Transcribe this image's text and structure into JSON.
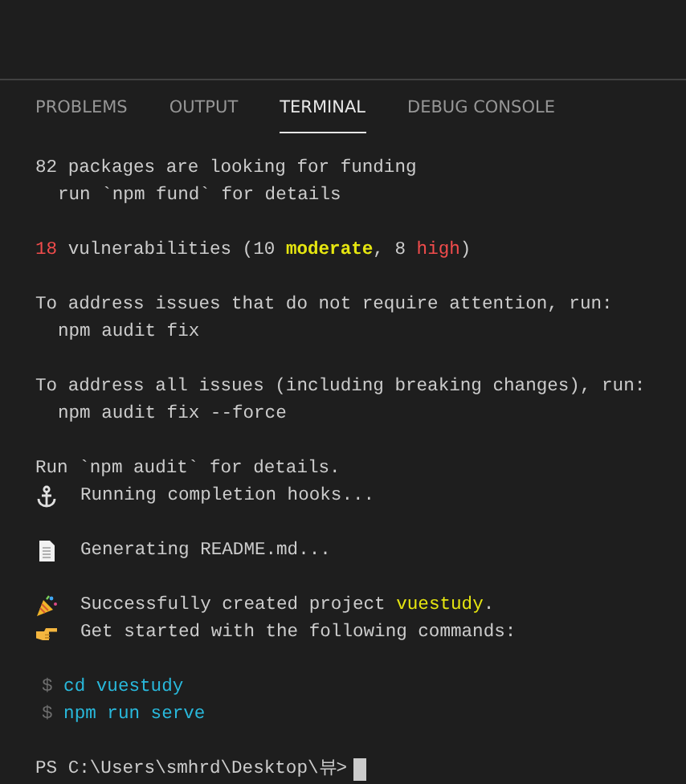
{
  "tabs": [
    {
      "label": "PROBLEMS",
      "selected": false
    },
    {
      "label": "OUTPUT",
      "selected": false
    },
    {
      "label": "TERMINAL",
      "selected": true
    },
    {
      "label": "DEBUG CONSOLE",
      "selected": false
    }
  ],
  "blocks": [
    [
      {
        "kind": "text",
        "segments": [
          {
            "text": "82 packages are looking for funding"
          }
        ]
      },
      {
        "kind": "indented",
        "segments": [
          {
            "text": "run `npm fund` for details"
          }
        ]
      }
    ],
    [
      {
        "kind": "text",
        "segments": [
          {
            "text": "18",
            "color": "#f14c4c"
          },
          {
            "text": " vulnerabilities (10 "
          },
          {
            "text": "moderate",
            "color": "#e5e510",
            "bold": true
          },
          {
            "text": ", 8 "
          },
          {
            "text": "high",
            "color": "#f14c4c"
          },
          {
            "text": ")"
          }
        ]
      }
    ],
    [
      {
        "kind": "text",
        "segments": [
          {
            "text": "To address issues that do not require attention, run:"
          }
        ]
      },
      {
        "kind": "indented",
        "segments": [
          {
            "text": "npm audit fix"
          }
        ]
      }
    ],
    [
      {
        "kind": "text",
        "segments": [
          {
            "text": "To address all issues (including breaking changes), run:"
          }
        ]
      },
      {
        "kind": "indented",
        "segments": [
          {
            "text": "npm audit fix --force"
          }
        ]
      }
    ],
    [
      {
        "kind": "text",
        "segments": [
          {
            "text": "Run `npm audit` for details."
          }
        ]
      },
      {
        "kind": "anchor",
        "segments": [
          {
            "text": "Running completion hooks..."
          }
        ]
      }
    ],
    [
      {
        "kind": "document",
        "segments": [
          {
            "text": "Generating README.md..."
          }
        ]
      }
    ],
    [
      {
        "kind": "party",
        "segments": [
          {
            "text": "Successfully created project "
          },
          {
            "text": "vuestudy",
            "color": "#e5e510"
          },
          {
            "text": "."
          }
        ]
      },
      {
        "kind": "hand",
        "segments": [
          {
            "text": "Get started with the following commands:"
          }
        ]
      }
    ],
    [
      {
        "kind": "command",
        "segments": [
          {
            "text": "$",
            "color": "#6e6e6e"
          },
          {
            "text": " cd vuestudy",
            "color": "#29b8db"
          }
        ]
      },
      {
        "kind": "command",
        "segments": [
          {
            "text": "$",
            "color": "#6e6e6e"
          },
          {
            "text": " npm run serve",
            "color": "#29b8db"
          }
        ]
      }
    ],
    [
      {
        "kind": "prompt",
        "segments": [
          {
            "text": "PS C:\\Users\\smhrd\\Desktop\\뷰>"
          }
        ]
      }
    ]
  ]
}
